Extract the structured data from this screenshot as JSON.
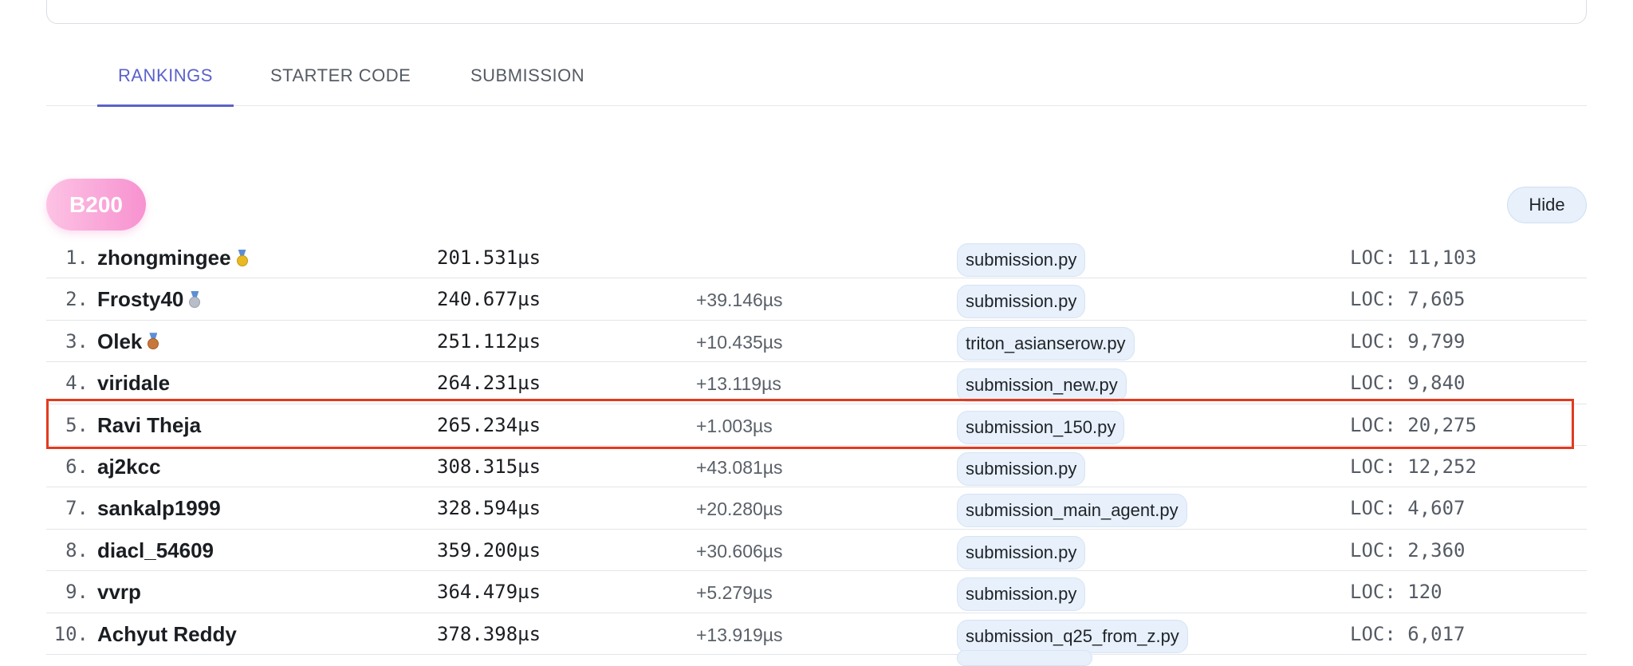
{
  "tabs": [
    {
      "label": "RANKINGS",
      "active": true
    },
    {
      "label": "STARTER CODE",
      "active": false
    },
    {
      "label": "SUBMISSION",
      "active": false
    }
  ],
  "gpu_badge": "B200",
  "hide_button": "Hide",
  "rankings": [
    {
      "rank": "1.",
      "name": "zhongmingee",
      "medal": "gold-medal",
      "time": "201.531µs",
      "delta": "",
      "file": "submission.py",
      "loc": "LOC: 11,103"
    },
    {
      "rank": "2.",
      "name": "Frosty40",
      "medal": "silver-medal",
      "time": "240.677µs",
      "delta": "+39.146µs",
      "file": "submission.py",
      "loc": "LOC: 7,605"
    },
    {
      "rank": "3.",
      "name": "Olek",
      "medal": "bronze-medal",
      "time": "251.112µs",
      "delta": "+10.435µs",
      "file": "triton_asianserow.py",
      "loc": "LOC: 9,799"
    },
    {
      "rank": "4.",
      "name": "viridale",
      "medal": "",
      "time": "264.231µs",
      "delta": "+13.119µs",
      "file": "submission_new.py",
      "loc": "LOC: 9,840"
    },
    {
      "rank": "5.",
      "name": "Ravi Theja",
      "medal": "",
      "time": "265.234µs",
      "delta": "+1.003µs",
      "file": "submission_150.py",
      "loc": "LOC: 20,275",
      "highlighted": true
    },
    {
      "rank": "6.",
      "name": "aj2kcc",
      "medal": "",
      "time": "308.315µs",
      "delta": "+43.081µs",
      "file": "submission.py",
      "loc": "LOC: 12,252"
    },
    {
      "rank": "7.",
      "name": "sankalp1999",
      "medal": "",
      "time": "328.594µs",
      "delta": "+20.280µs",
      "file": "submission_main_agent.py",
      "loc": "LOC: 4,607"
    },
    {
      "rank": "8.",
      "name": "diacl_54609",
      "medal": "",
      "time": "359.200µs",
      "delta": "+30.606µs",
      "file": "submission.py",
      "loc": "LOC: 2,360"
    },
    {
      "rank": "9.",
      "name": "vvrp",
      "medal": "",
      "time": "364.479µs",
      "delta": "+5.279µs",
      "file": "submission.py",
      "loc": "LOC: 120"
    },
    {
      "rank": "10.",
      "name": "Achyut Reddy",
      "medal": "",
      "time": "378.398µs",
      "delta": "+13.919µs",
      "file": "submission_q25_from_z.py",
      "loc": "LOC: 6,017"
    }
  ],
  "colors": {
    "accent": "#5b61c9",
    "badge_pink": "#f792d0",
    "chip_bg": "#e7f0fb",
    "highlight_border": "#e23a1e"
  }
}
